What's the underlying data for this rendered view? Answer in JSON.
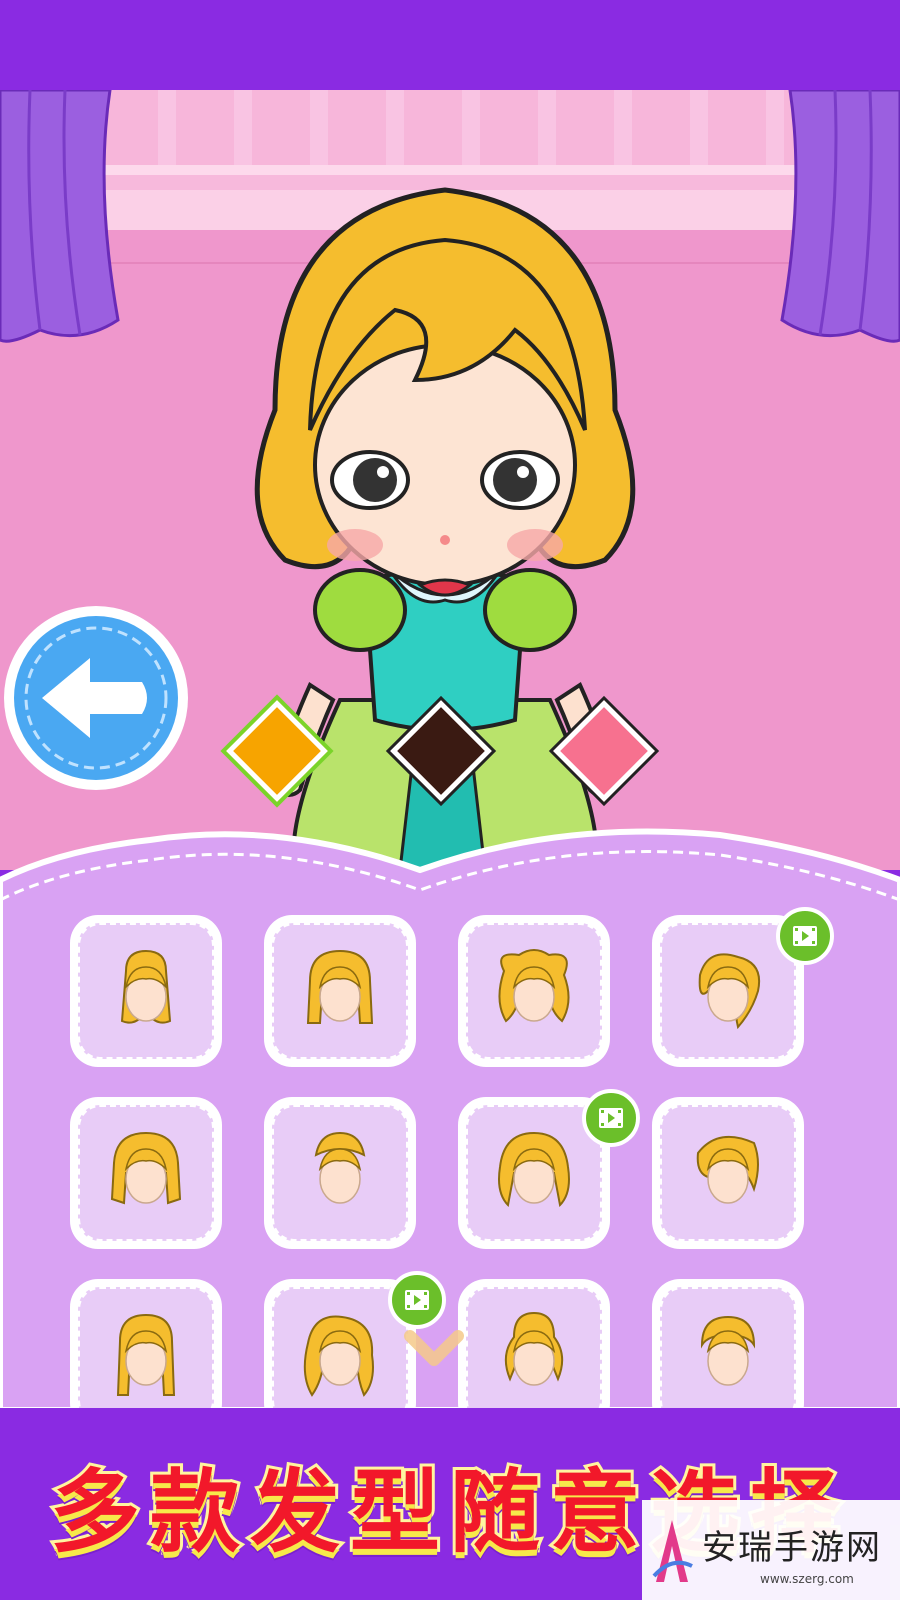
{
  "app": {
    "banner_text": "多款发型随意选择",
    "brand_color": "#8a2be2",
    "background_color": "#ef97cc",
    "panel_color": "#d9a2f3"
  },
  "back_button": {
    "icon": "arrow-left-icon",
    "color": "#4aa8f2"
  },
  "hair_colors": [
    {
      "name": "orange",
      "hex": "#f7a400",
      "selected": true
    },
    {
      "name": "dark-brown",
      "hex": "#3a1a12",
      "selected": false
    },
    {
      "name": "pink",
      "hex": "#f7718f",
      "selected": false
    }
  ],
  "hairstyles": [
    {
      "id": 1,
      "locked_by_video": false
    },
    {
      "id": 2,
      "locked_by_video": false
    },
    {
      "id": 3,
      "locked_by_video": false
    },
    {
      "id": 4,
      "locked_by_video": true
    },
    {
      "id": 5,
      "locked_by_video": false
    },
    {
      "id": 6,
      "locked_by_video": false
    },
    {
      "id": 7,
      "locked_by_video": true
    },
    {
      "id": 8,
      "locked_by_video": false
    },
    {
      "id": 9,
      "locked_by_video": false
    },
    {
      "id": 10,
      "locked_by_video": true
    },
    {
      "id": 11,
      "locked_by_video": false
    },
    {
      "id": 12,
      "locked_by_video": false
    }
  ],
  "watermark": {
    "name": "安瑞手游网",
    "url": "www.szerg.com"
  }
}
